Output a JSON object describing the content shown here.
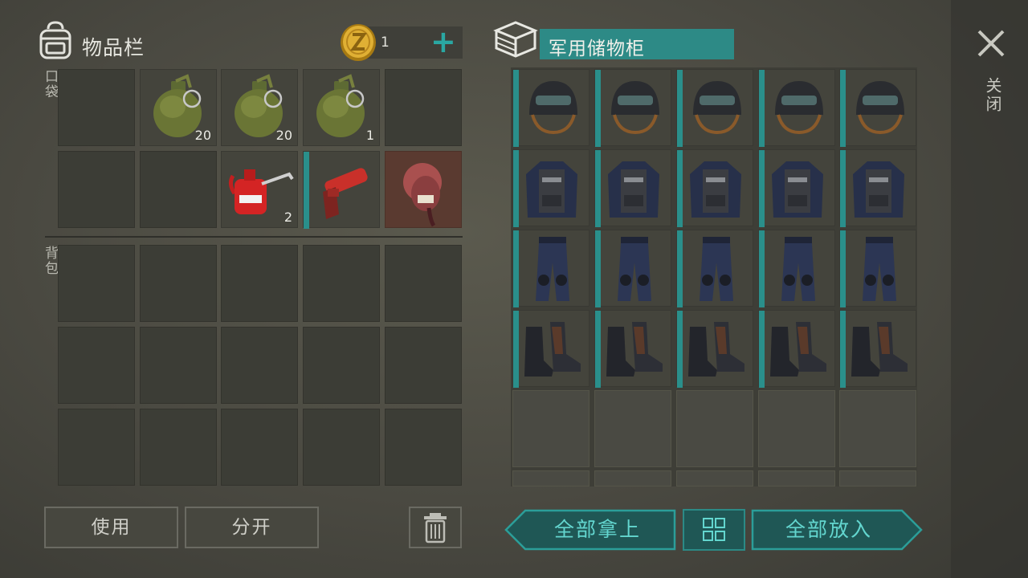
{
  "inventory": {
    "title": "物品栏",
    "coins": "1",
    "pocket_label": "口袋",
    "backpack_label": "背包",
    "pocket_slots": [
      {
        "item": "",
        "count": ""
      },
      {
        "item": "grenade",
        "count": "20"
      },
      {
        "item": "grenade",
        "count": "20"
      },
      {
        "item": "grenade",
        "count": "1"
      },
      {
        "item": "",
        "count": ""
      },
      {
        "item": "",
        "count": ""
      },
      {
        "item": "",
        "count": ""
      },
      {
        "item": "oil-can",
        "count": "2"
      },
      {
        "item": "flare-gun",
        "count": ""
      },
      {
        "item": "zombie-head",
        "count": ""
      }
    ]
  },
  "storage": {
    "title": "军用储物柜",
    "rows": [
      "helmet",
      "vest",
      "pants",
      "boots"
    ]
  },
  "buttons": {
    "use": "使用",
    "split": "分开",
    "take_all": "全部拿上",
    "put_all": "全部放入",
    "close": "关闭"
  },
  "colors": {
    "accent": "#2a8f8b",
    "accent_text": "#63d6cf",
    "coin": "#d8a62a"
  }
}
